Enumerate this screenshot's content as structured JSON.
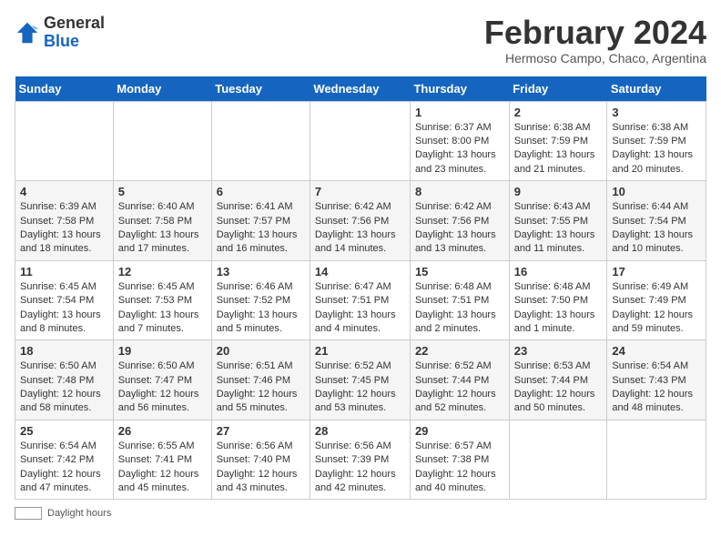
{
  "header": {
    "logo_general": "General",
    "logo_blue": "Blue",
    "month_year": "February 2024",
    "location": "Hermoso Campo, Chaco, Argentina"
  },
  "days_of_week": [
    "Sunday",
    "Monday",
    "Tuesday",
    "Wednesday",
    "Thursday",
    "Friday",
    "Saturday"
  ],
  "weeks": [
    [
      {
        "day": "",
        "info": ""
      },
      {
        "day": "",
        "info": ""
      },
      {
        "day": "",
        "info": ""
      },
      {
        "day": "",
        "info": ""
      },
      {
        "day": "1",
        "info": "Sunrise: 6:37 AM\nSunset: 8:00 PM\nDaylight: 13 hours and 23 minutes."
      },
      {
        "day": "2",
        "info": "Sunrise: 6:38 AM\nSunset: 7:59 PM\nDaylight: 13 hours and 21 minutes."
      },
      {
        "day": "3",
        "info": "Sunrise: 6:38 AM\nSunset: 7:59 PM\nDaylight: 13 hours and 20 minutes."
      }
    ],
    [
      {
        "day": "4",
        "info": "Sunrise: 6:39 AM\nSunset: 7:58 PM\nDaylight: 13 hours and 18 minutes."
      },
      {
        "day": "5",
        "info": "Sunrise: 6:40 AM\nSunset: 7:58 PM\nDaylight: 13 hours and 17 minutes."
      },
      {
        "day": "6",
        "info": "Sunrise: 6:41 AM\nSunset: 7:57 PM\nDaylight: 13 hours and 16 minutes."
      },
      {
        "day": "7",
        "info": "Sunrise: 6:42 AM\nSunset: 7:56 PM\nDaylight: 13 hours and 14 minutes."
      },
      {
        "day": "8",
        "info": "Sunrise: 6:42 AM\nSunset: 7:56 PM\nDaylight: 13 hours and 13 minutes."
      },
      {
        "day": "9",
        "info": "Sunrise: 6:43 AM\nSunset: 7:55 PM\nDaylight: 13 hours and 11 minutes."
      },
      {
        "day": "10",
        "info": "Sunrise: 6:44 AM\nSunset: 7:54 PM\nDaylight: 13 hours and 10 minutes."
      }
    ],
    [
      {
        "day": "11",
        "info": "Sunrise: 6:45 AM\nSunset: 7:54 PM\nDaylight: 13 hours and 8 minutes."
      },
      {
        "day": "12",
        "info": "Sunrise: 6:45 AM\nSunset: 7:53 PM\nDaylight: 13 hours and 7 minutes."
      },
      {
        "day": "13",
        "info": "Sunrise: 6:46 AM\nSunset: 7:52 PM\nDaylight: 13 hours and 5 minutes."
      },
      {
        "day": "14",
        "info": "Sunrise: 6:47 AM\nSunset: 7:51 PM\nDaylight: 13 hours and 4 minutes."
      },
      {
        "day": "15",
        "info": "Sunrise: 6:48 AM\nSunset: 7:51 PM\nDaylight: 13 hours and 2 minutes."
      },
      {
        "day": "16",
        "info": "Sunrise: 6:48 AM\nSunset: 7:50 PM\nDaylight: 13 hours and 1 minute."
      },
      {
        "day": "17",
        "info": "Sunrise: 6:49 AM\nSunset: 7:49 PM\nDaylight: 12 hours and 59 minutes."
      }
    ],
    [
      {
        "day": "18",
        "info": "Sunrise: 6:50 AM\nSunset: 7:48 PM\nDaylight: 12 hours and 58 minutes."
      },
      {
        "day": "19",
        "info": "Sunrise: 6:50 AM\nSunset: 7:47 PM\nDaylight: 12 hours and 56 minutes."
      },
      {
        "day": "20",
        "info": "Sunrise: 6:51 AM\nSunset: 7:46 PM\nDaylight: 12 hours and 55 minutes."
      },
      {
        "day": "21",
        "info": "Sunrise: 6:52 AM\nSunset: 7:45 PM\nDaylight: 12 hours and 53 minutes."
      },
      {
        "day": "22",
        "info": "Sunrise: 6:52 AM\nSunset: 7:44 PM\nDaylight: 12 hours and 52 minutes."
      },
      {
        "day": "23",
        "info": "Sunrise: 6:53 AM\nSunset: 7:44 PM\nDaylight: 12 hours and 50 minutes."
      },
      {
        "day": "24",
        "info": "Sunrise: 6:54 AM\nSunset: 7:43 PM\nDaylight: 12 hours and 48 minutes."
      }
    ],
    [
      {
        "day": "25",
        "info": "Sunrise: 6:54 AM\nSunset: 7:42 PM\nDaylight: 12 hours and 47 minutes."
      },
      {
        "day": "26",
        "info": "Sunrise: 6:55 AM\nSunset: 7:41 PM\nDaylight: 12 hours and 45 minutes."
      },
      {
        "day": "27",
        "info": "Sunrise: 6:56 AM\nSunset: 7:40 PM\nDaylight: 12 hours and 43 minutes."
      },
      {
        "day": "28",
        "info": "Sunrise: 6:56 AM\nSunset: 7:39 PM\nDaylight: 12 hours and 42 minutes."
      },
      {
        "day": "29",
        "info": "Sunrise: 6:57 AM\nSunset: 7:38 PM\nDaylight: 12 hours and 40 minutes."
      },
      {
        "day": "",
        "info": ""
      },
      {
        "day": "",
        "info": ""
      }
    ]
  ],
  "footer": {
    "daylight_label": "Daylight hours"
  }
}
